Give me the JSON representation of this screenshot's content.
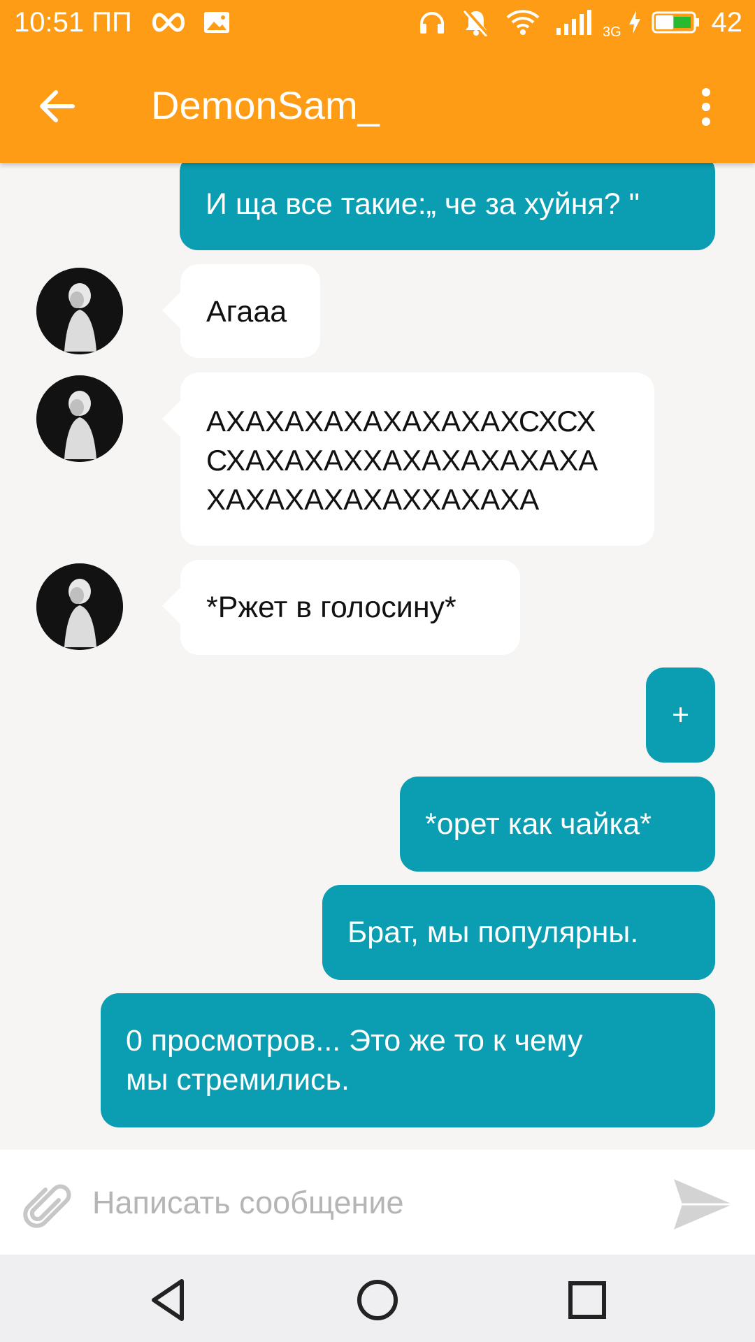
{
  "status_bar": {
    "time": "10:51 ПП",
    "network_label": "3G",
    "battery_percent": "42",
    "icons": [
      "infinity-icon",
      "image-notification-icon",
      "headphones-icon",
      "bell-off-icon",
      "wifi-icon",
      "signal-icon",
      "charging-icon",
      "battery-icon"
    ]
  },
  "app_bar": {
    "title": "DemonSam_",
    "icons": [
      "back-arrow-icon",
      "more-vert-icon"
    ]
  },
  "messages": [
    {
      "direction": "out",
      "text": "И ща все такие:„ че за хуйня? \""
    },
    {
      "direction": "in",
      "text": "Агааа"
    },
    {
      "direction": "in",
      "text": "АХАХАХАХАХАХАХАХСХСХ\nСХАХАХАХХАХАХАХАХАХА\nХАХАХАХАХАХХАХАХА"
    },
    {
      "direction": "in",
      "text": "*Ржет в голосину*"
    },
    {
      "direction": "out",
      "text": "+"
    },
    {
      "direction": "out",
      "text": "*орет как чайка*"
    },
    {
      "direction": "out",
      "text": "Брат, мы популярны."
    },
    {
      "direction": "out",
      "text": "0 просмотров... Это же то к чему\nмы стремились."
    }
  ],
  "composer": {
    "placeholder": "Написать сообщение",
    "icons": [
      "paperclip-icon",
      "send-icon"
    ]
  },
  "nav_bar": {
    "icons": [
      "nav-back-icon",
      "nav-home-icon",
      "nav-recents-icon"
    ]
  },
  "colors": {
    "app_bar": "#fe9c15",
    "outgoing_bubble": "#0b9db1",
    "incoming_bubble": "#ffffff",
    "chat_background": "#f7f5f3",
    "nav_bar": "#efeef0"
  }
}
